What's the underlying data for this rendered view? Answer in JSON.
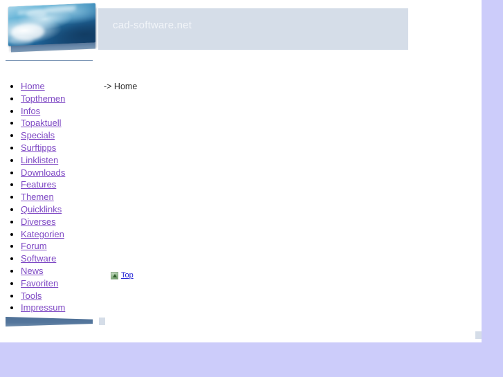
{
  "header": {
    "site_title": "cad-software.net",
    "banner_icon": "ocean-wave-photo"
  },
  "sidebar": {
    "items": [
      {
        "label": "Home",
        "name": "sidebar-item-home"
      },
      {
        "label": "Topthemen",
        "name": "sidebar-item-topthemen"
      },
      {
        "label": "Infos",
        "name": "sidebar-item-infos"
      },
      {
        "label": "Topaktuell",
        "name": "sidebar-item-topaktuell"
      },
      {
        "label": "Specials",
        "name": "sidebar-item-specials"
      },
      {
        "label": "Surftipps",
        "name": "sidebar-item-surftipps"
      },
      {
        "label": "Linklisten",
        "name": "sidebar-item-linklisten"
      },
      {
        "label": "Downloads",
        "name": "sidebar-item-downloads"
      },
      {
        "label": "Features",
        "name": "sidebar-item-features"
      },
      {
        "label": "Themen",
        "name": "sidebar-item-themen"
      },
      {
        "label": "Quicklinks",
        "name": "sidebar-item-quicklinks"
      },
      {
        "label": "Diverses",
        "name": "sidebar-item-diverses"
      },
      {
        "label": "Kategorien",
        "name": "sidebar-item-kategorien"
      },
      {
        "label": "Forum",
        "name": "sidebar-item-forum"
      },
      {
        "label": "Software",
        "name": "sidebar-item-software"
      },
      {
        "label": "News",
        "name": "sidebar-item-news"
      },
      {
        "label": "Favoriten",
        "name": "sidebar-item-favoriten"
      },
      {
        "label": "Tools",
        "name": "sidebar-item-tools"
      },
      {
        "label": "Impressum",
        "name": "sidebar-item-impressum"
      }
    ]
  },
  "main": {
    "breadcrumb": "-> Home",
    "top_link_label": "Top",
    "top_link_icon": "up-arrow-icon"
  },
  "colors": {
    "page_background": "#ccccfa",
    "canvas": "#ffffff",
    "header_box": "#d5dde8",
    "title_text": "#f2f5f9",
    "link": "#7e48c4",
    "top_link": "#2525d6",
    "rule": "#7d97b6",
    "footer_wedge": "#4e7096"
  }
}
